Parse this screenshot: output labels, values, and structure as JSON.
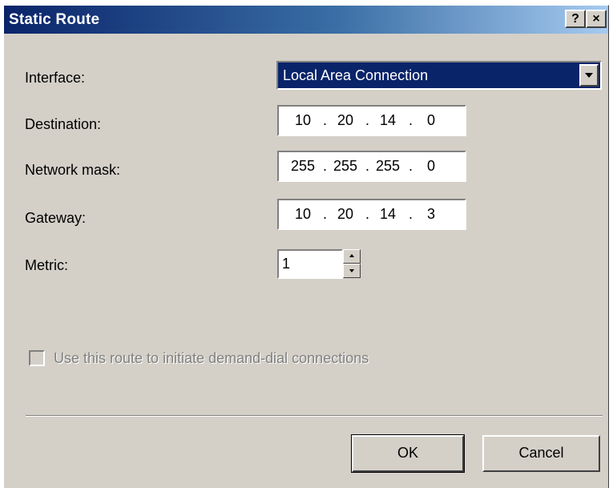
{
  "window": {
    "title": "Static Route",
    "help_label": "?",
    "close_label": "×"
  },
  "form": {
    "interface_label": "Interface:",
    "interface_value": "Local Area Connection",
    "destination_label": "Destination:",
    "destination": [
      "10",
      "20",
      "14",
      "0"
    ],
    "mask_label": "Network mask:",
    "mask": [
      "255",
      "255",
      "255",
      "0"
    ],
    "gateway_label": "Gateway:",
    "gateway": [
      "10",
      "20",
      "14",
      "3"
    ],
    "separator": ".",
    "metric_label": "Metric:",
    "metric_value": "1",
    "demand_dial_label": "Use this route to initiate demand-dial connections",
    "demand_dial_checked": false,
    "demand_dial_enabled": false
  },
  "buttons": {
    "ok": "OK",
    "cancel": "Cancel"
  },
  "colors": {
    "dialog_face": "#d4d0c8",
    "titlebar_start": "#0a246a",
    "titlebar_end": "#a6caf0",
    "selection": "#0a246a",
    "disabled_text": "#808080"
  },
  "icons": {
    "combo_dropdown": "chevron-down-icon",
    "spin_up": "chevron-up-icon",
    "spin_down": "chevron-down-icon"
  }
}
